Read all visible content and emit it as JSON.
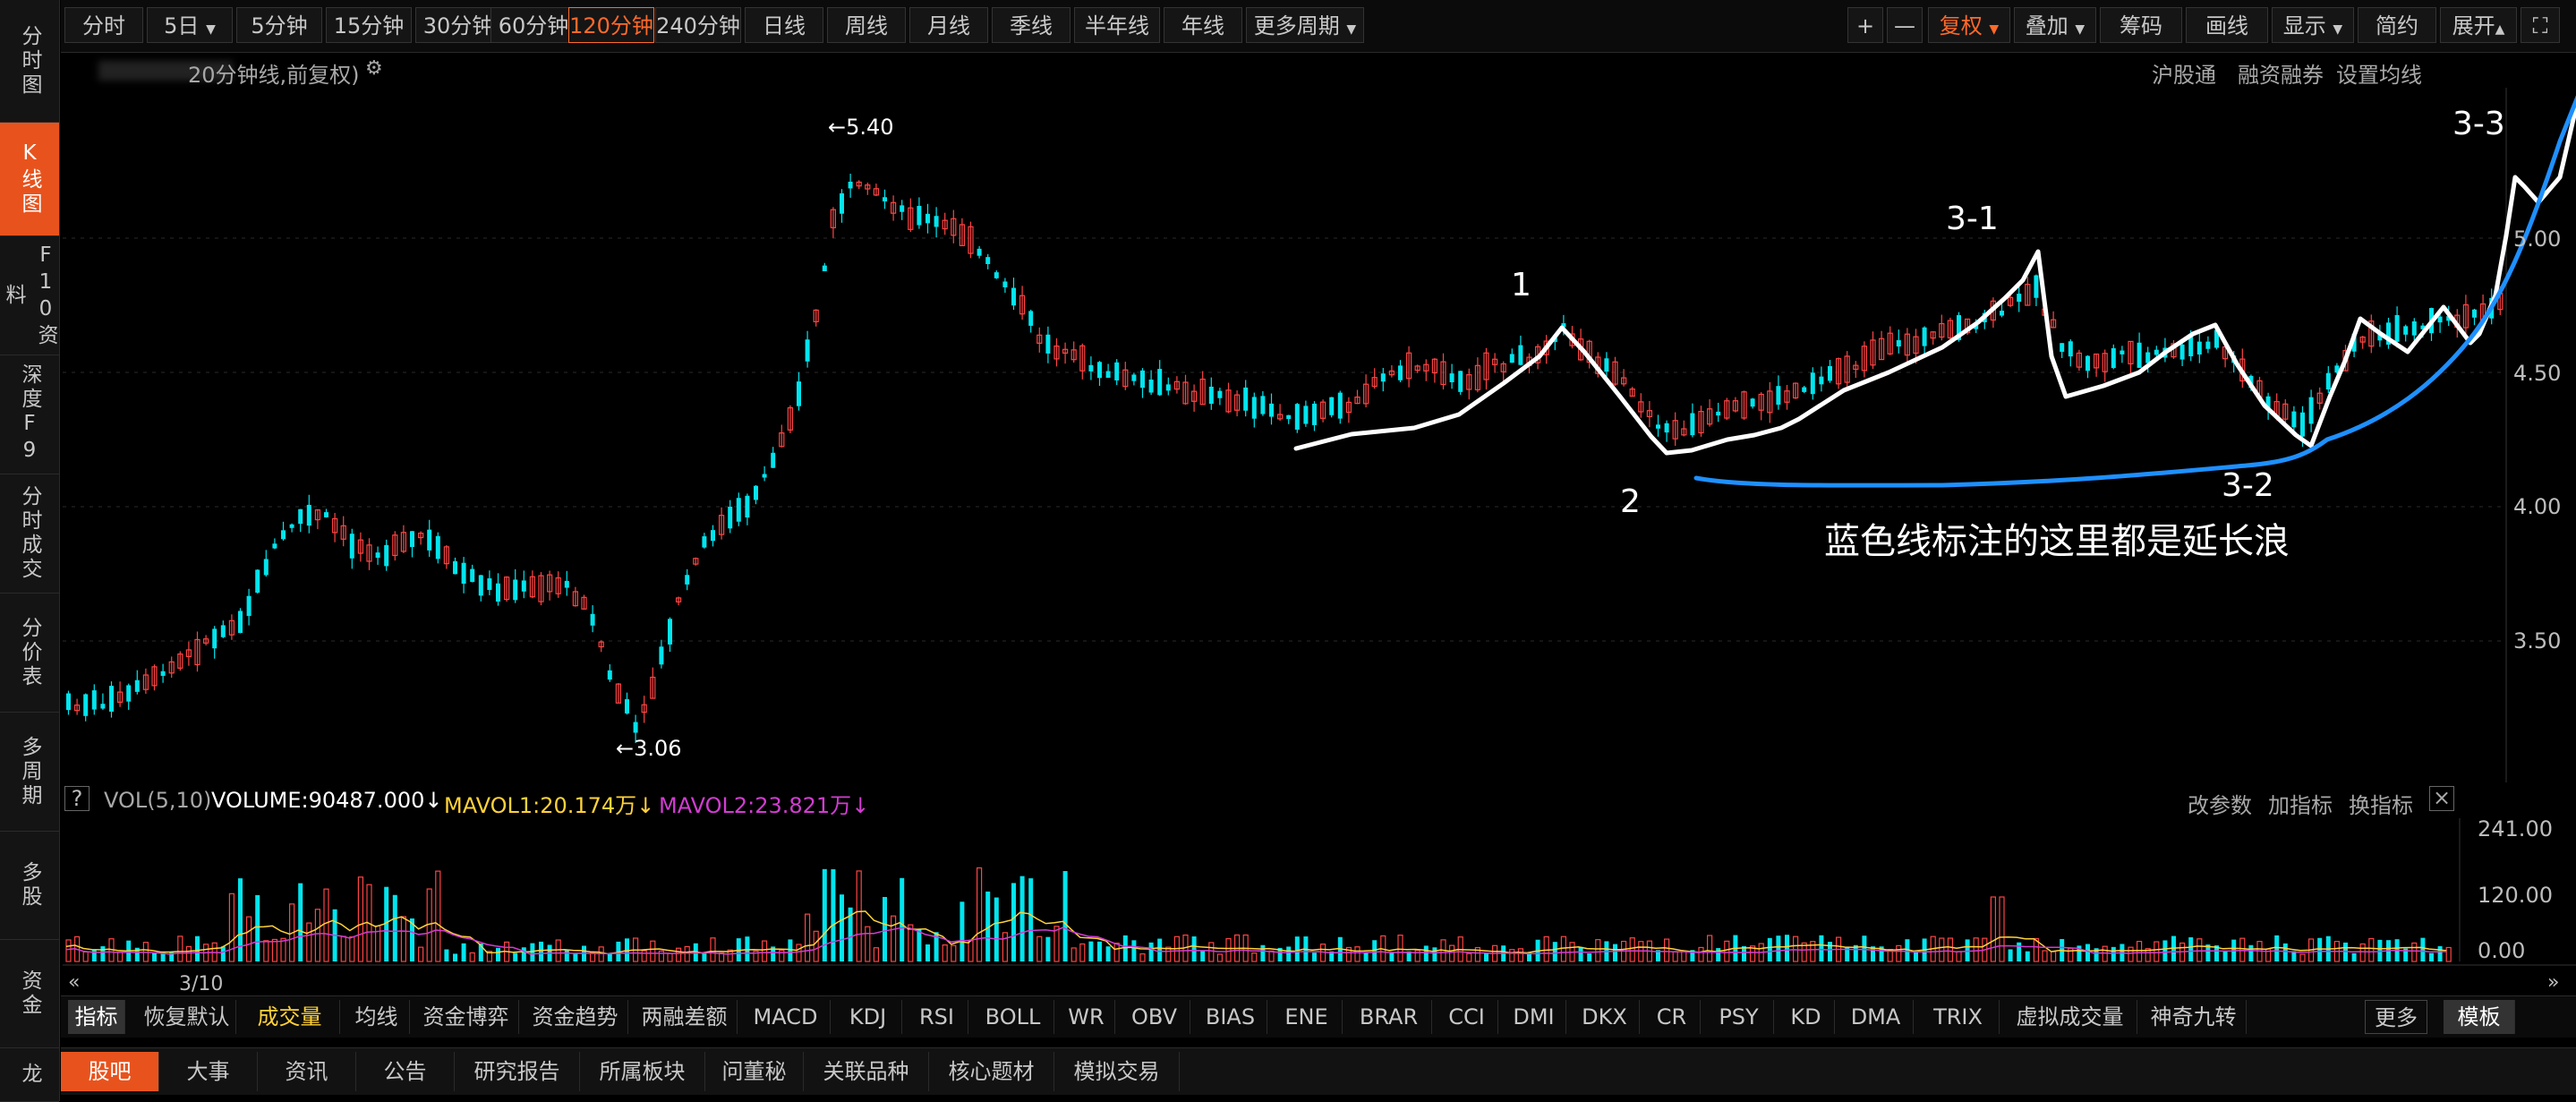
{
  "sidebar": {
    "items": [
      {
        "label": "分时图"
      },
      {
        "label": "K线图",
        "active": true
      },
      {
        "label": "F10资料"
      },
      {
        "label": "深度F9"
      },
      {
        "label": "分时成交"
      },
      {
        "label": "分价表"
      },
      {
        "label": "多周期"
      },
      {
        "label": "多股"
      },
      {
        "label": "资金"
      },
      {
        "label": "龙"
      }
    ]
  },
  "toolbar": {
    "periods": [
      "分时",
      "5日",
      "5分钟",
      "15分钟",
      "30分钟",
      "60分钟",
      "120分钟",
      "240分钟",
      "日线",
      "周线",
      "月线",
      "季线",
      "半年线",
      "年线",
      "更多周期"
    ],
    "active_period": "120分钟",
    "zoom_in": "+",
    "zoom_out": "—",
    "fuquan": "复权",
    "diejia": "叠加",
    "chouma": "筹码",
    "huaxian": "画线",
    "xianshi": "显示",
    "jianyue": "简约",
    "zhankai": "展开"
  },
  "title": {
    "text": "20分钟线,前复权)",
    "hugutong": "沪股通",
    "rongzi": "融资融券",
    "shezhi": "设置均线"
  },
  "price_axis": {
    "labels": [
      "5.00",
      "4.50",
      "4.00",
      "3.50"
    ]
  },
  "annotations": {
    "high": "5.40",
    "low": "3.06",
    "wave_1": "1",
    "wave_2": "2",
    "wave_3_1": "3-1",
    "wave_3_2": "3-2",
    "wave_3_3": "3-3",
    "note": "蓝色线标注的这里都是延长浪"
  },
  "volume": {
    "help": "?",
    "name": "VOL(5,10)",
    "volume_label": "VOLUME:90487.000",
    "mavol1_label": "MAVOL1:20.174万",
    "mavol2_label": "MAVOL2:23.821万",
    "arrow": "↓",
    "gaicanshu": "改参数",
    "jiazhibiao": "加指标",
    "huanzhibiao": "换指标",
    "close": "×",
    "axis_labels": [
      "241.00",
      "120.00",
      "0.00"
    ],
    "date_label": "3/10"
  },
  "indicators": {
    "tabs": [
      "指标",
      "恢复默认",
      "成交量",
      "均线",
      "资金博弈",
      "资金趋势",
      "两融差额",
      "MACD",
      "KDJ",
      "RSI",
      "BOLL",
      "WR",
      "OBV",
      "BIAS",
      "ENE",
      "BRAR",
      "CCI",
      "DMI",
      "DKX",
      "CR",
      "PSY",
      "KD",
      "DMA",
      "TRIX",
      "虚拟成交量",
      "神奇九转",
      "更多",
      "模板"
    ]
  },
  "info_tabs": {
    "tabs": [
      "股吧",
      "大事",
      "资讯",
      "公告",
      "研究报告",
      "所属板块",
      "问董秘",
      "关联品种",
      "核心题材",
      "模拟交易"
    ]
  },
  "colors": {
    "up": "#ff4444",
    "down": "#00e5ee",
    "accent": "#e8531d",
    "wave_white": "#ffffff",
    "wave_blue": "#1e90ff",
    "mavol1": "#ffd23a",
    "mavol2": "#d23cd2"
  }
}
